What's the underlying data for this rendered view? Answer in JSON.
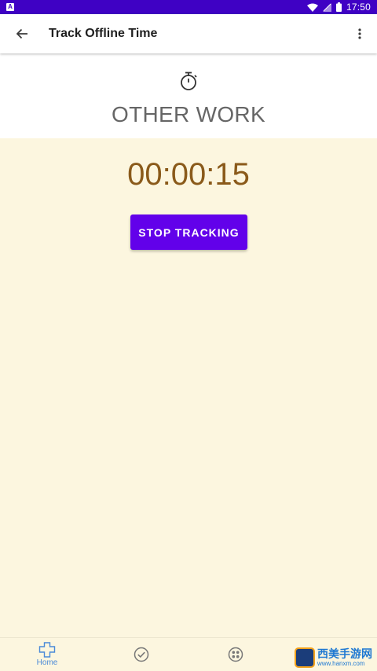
{
  "status_bar": {
    "notification_icon": "A",
    "time": "17:50"
  },
  "app_bar": {
    "title": "Track Offline Time",
    "back_icon": "arrow-left-icon",
    "menu_icon": "more-vert-icon"
  },
  "header": {
    "icon": "stopwatch-icon",
    "category": "OTHER WORK"
  },
  "tracker": {
    "elapsed": "00:00:15",
    "stop_label": "STOP TRACKING"
  },
  "bottom_nav": {
    "items": [
      {
        "label": "Home",
        "icon": "health-cross-icon",
        "active": true
      },
      {
        "label": "",
        "icon": "check-circle-icon",
        "active": false
      },
      {
        "label": "",
        "icon": "apps-circle-icon",
        "active": false
      }
    ]
  },
  "watermark": {
    "name": "西美手游网",
    "url": "www.hanxm.com"
  },
  "colors": {
    "status_bar": "#3f01c4",
    "accent": "#6201ea",
    "timer_text": "#8a5a1a",
    "background_tint": "#fcf6df",
    "nav_active": "#4a8ad8"
  }
}
